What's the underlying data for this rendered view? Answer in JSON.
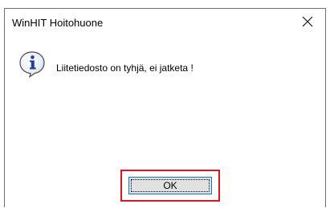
{
  "window": {
    "title": "WinHIT Hoitohuone",
    "close_icon": "close-icon"
  },
  "message": {
    "icon": "info-icon",
    "text": "Liitetiedosto on tyhjä, ei jatketa !"
  },
  "buttons": {
    "ok_label": "OK"
  },
  "colors": {
    "highlight": "#e2141f",
    "button_face": "#e1e1e1",
    "button_focus_border": "#0078d7",
    "info_icon_blue": "#1f3f9a"
  }
}
